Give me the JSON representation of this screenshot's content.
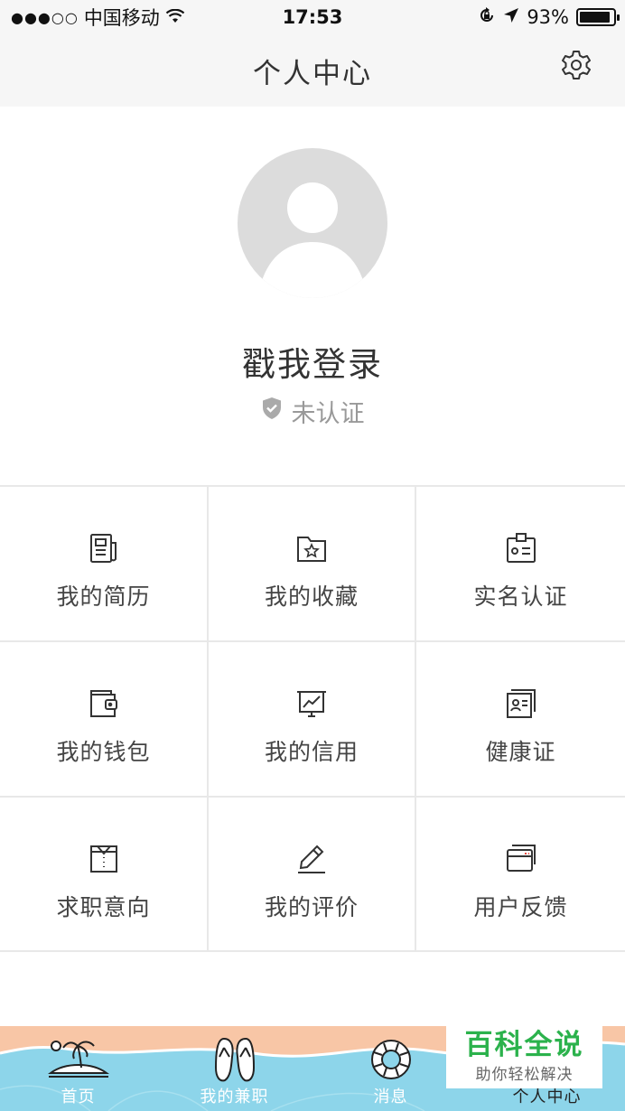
{
  "status_bar": {
    "signal": "●●●○○",
    "carrier": "中国移动",
    "time": "17:53",
    "battery_text": "93%",
    "battery_level": 0.93
  },
  "nav": {
    "title": "个人中心",
    "settings_icon": "gear-icon"
  },
  "profile": {
    "login_label": "戳我登录",
    "verify_status": "未认证",
    "verify_icon": "shield-check-icon"
  },
  "menu": [
    {
      "label": "我的简历",
      "icon": "resume-icon"
    },
    {
      "label": "我的收藏",
      "icon": "folder-star-icon"
    },
    {
      "label": "实名认证",
      "icon": "id-badge-icon"
    },
    {
      "label": "我的钱包",
      "icon": "wallet-icon"
    },
    {
      "label": "我的信用",
      "icon": "credit-chart-icon"
    },
    {
      "label": "健康证",
      "icon": "health-card-icon"
    },
    {
      "label": "求职意向",
      "icon": "job-intention-icon"
    },
    {
      "label": "我的评价",
      "icon": "pencil-icon"
    },
    {
      "label": "用户反馈",
      "icon": "feedback-cards-icon"
    }
  ],
  "tabs": [
    {
      "label": "首页",
      "icon": "island-icon",
      "active": false
    },
    {
      "label": "我的兼职",
      "icon": "flip-flops-icon",
      "active": false
    },
    {
      "label": "消息",
      "icon": "lifebuoy-icon",
      "active": false
    },
    {
      "label": "个人中心",
      "icon": "person-icon",
      "active": true
    }
  ],
  "watermark": {
    "title": "百科全说",
    "subtitle": "助你轻松解决"
  },
  "colors": {
    "nav_bg": "#f6f6f6",
    "divider": "#e8e8e8",
    "avatar_bg": "#dcdcdc",
    "muted_text": "#999999",
    "watermark_green": "#2bb24c"
  }
}
